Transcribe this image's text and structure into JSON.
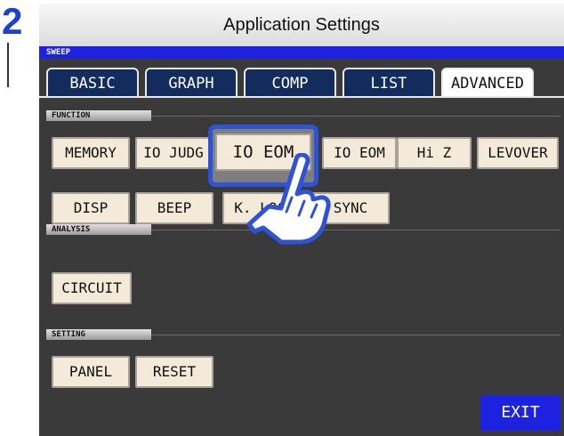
{
  "step": {
    "number": "2"
  },
  "app": {
    "title": "Application Settings",
    "mode": "SWEEP"
  },
  "tabs": [
    {
      "label": "BASIC",
      "active": false
    },
    {
      "label": "GRAPH",
      "active": false
    },
    {
      "label": "COMP",
      "active": false
    },
    {
      "label": "LIST",
      "active": false
    },
    {
      "label": "ADVANCED",
      "active": true
    }
  ],
  "sections": {
    "function": {
      "header": "FUNCTION",
      "row1": [
        "MEMORY",
        "IO JUDG",
        "IO EOM",
        "IO EOM",
        "Hi Z",
        "LEVOVER"
      ],
      "row2": [
        "DISP",
        "BEEP",
        "K. LOCK",
        "SYNC"
      ],
      "selected": "IO EOM"
    },
    "analysis": {
      "header": "ANALYSIS",
      "items": [
        "CIRCUIT"
      ]
    },
    "setting": {
      "header": "SETTING",
      "items": [
        "PANEL",
        "RESET"
      ]
    }
  },
  "exit_label": "EXIT",
  "colors": {
    "accent": "#1d22e0",
    "tab": "#122c5e",
    "button": "#f3ead9",
    "highlight": "#2f53d8"
  }
}
